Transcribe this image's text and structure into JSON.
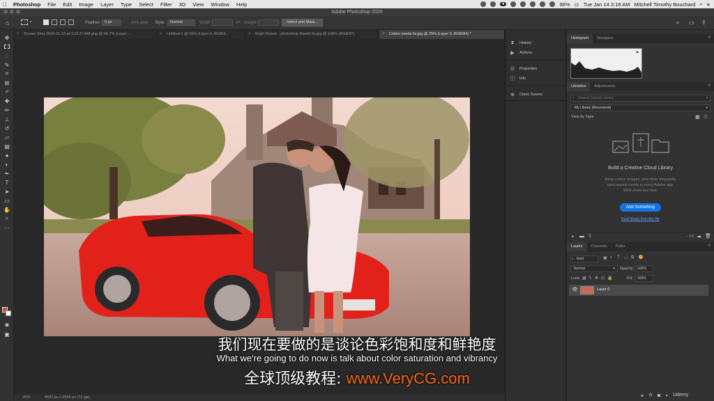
{
  "menubar": {
    "app": "Photoshop",
    "items": [
      "File",
      "Edit",
      "Image",
      "Layer",
      "Type",
      "Select",
      "Filter",
      "3D",
      "View",
      "Window",
      "Help"
    ],
    "battery": "96%",
    "clock": "Tue Jan 14  3:18 AM",
    "user": "Mitchell Timothy Bouchard"
  },
  "window": {
    "title": "Adobe Photoshop 2020"
  },
  "options": {
    "feather_label": "Feather:",
    "feather_value": "0 px",
    "antialias_label": "Anti-alias",
    "style_label": "Style:",
    "style_value": "Normal",
    "width_label": "Width:",
    "height_label": "Height:",
    "select_mask": "Select and Mask..."
  },
  "tabs": [
    {
      "label": "Screen Shot 2020-01-13 at 3.23.27 AM.png @ 66.7% (Layer ...",
      "active": false
    },
    {
      "label": "Untitled-1 @ 50% (Layer 0, RGB/8...",
      "active": false
    },
    {
      "label": "Brigh Picture - photoshop Needs fix.jpg @ 100% (RGB/8*)",
      "active": false
    },
    {
      "label": "Colors needs fix.jpg @ 25% (Layer 0, RGB/8#) *",
      "active": true
    }
  ],
  "status": {
    "zoom": "25%",
    "doc_size": "4592 px x 2584 px (72 ppi)"
  },
  "subtitles": {
    "chinese": "我们现在要做的是谈论色彩饱和度和鲜艳度",
    "english": "What we're going to do now is talk about color saturation and vibrancy",
    "watermark_prefix": "全球顶级教程: ",
    "watermark_url": "www.VeryCG.com"
  },
  "mid_dock": {
    "items": [
      {
        "label": "History",
        "icon": "history-icon"
      },
      {
        "label": "Actions",
        "icon": "play-icon"
      },
      {
        "label": "Properties",
        "icon": "sliders-icon"
      },
      {
        "label": "Info",
        "icon": "info-icon"
      },
      {
        "label": "Clone Source",
        "icon": "clone-source-icon"
      }
    ]
  },
  "histogram_panel": {
    "tabs": [
      "Histogram",
      "Navigator"
    ]
  },
  "libraries_panel": {
    "tabs": [
      "Libraries",
      "Adjustments"
    ],
    "search_placeholder": "Search Current Library",
    "library_select": "My Library (Recovered)",
    "view_by": "View by Type",
    "heading": "Build a Creative Cloud Library",
    "description_1": "Keep colors, images, and other frequently",
    "description_2": "used assets handy in every Adobe app.",
    "description_3": "We'll show you how.",
    "add_button": "Add Something",
    "learn_link": "Build library from this file",
    "size": "-- KB"
  },
  "layers_panel": {
    "tabs": [
      "Layers",
      "Channels",
      "Paths"
    ],
    "kind": "Kind",
    "blend_mode": "Normal",
    "opacity_label": "Opacity:",
    "opacity_value": "100%",
    "lock_label": "Lock:",
    "fill_label": "Fill:",
    "fill_value": "100%",
    "layers": [
      {
        "name": "Layer 0",
        "visible": true
      }
    ]
  },
  "branding": {
    "udemy": "Udemy"
  },
  "colors": {
    "foreground": "#c65a2a",
    "background": "#ffffff",
    "accent_blue": "#1473e6",
    "watermark_orange": "#ff6a1a"
  }
}
